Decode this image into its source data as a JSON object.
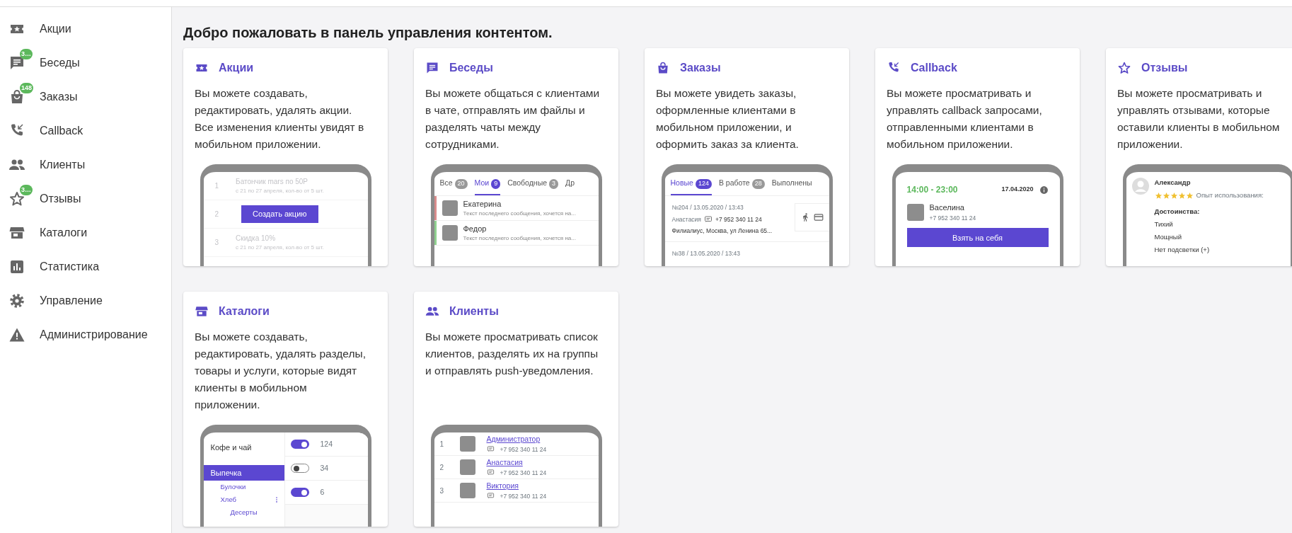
{
  "sidebar": {
    "items": [
      {
        "label": "Акции"
      },
      {
        "label": "Беседы",
        "badge": "3…"
      },
      {
        "label": "Заказы",
        "badge": "148"
      },
      {
        "label": "Callback"
      },
      {
        "label": "Клиенты"
      },
      {
        "label": "Отзывы",
        "badge": "3…"
      },
      {
        "label": "Каталоги"
      },
      {
        "label": "Статистика"
      },
      {
        "label": "Управление"
      },
      {
        "label": "Администрирование"
      }
    ]
  },
  "heading": "Добро пожаловать в панель управления контентом.",
  "cards": [
    {
      "kind": "promos",
      "title": "Акции",
      "text": "Вы можете создавать, редактировать, удалять акции. Все изменения клиенты увидят в мобильном приложении.",
      "preview": {
        "rows": [
          {
            "num": "1",
            "title": "Батончик mars по 50Р",
            "subtitle": "с 21 по 27 апреля, кол-во от 5 шт."
          },
          {
            "num": "2"
          },
          {
            "num": "3",
            "title": "Скидка 10%",
            "subtitle": "с 21 по 27 апреля, кол-во от 5 шт."
          }
        ],
        "button": "Создать акцию"
      }
    },
    {
      "kind": "chats",
      "title": "Беседы",
      "text": "Вы можете общаться с клиентами в чате, отправлять им файлы и разделять чаты между сотрудниками.",
      "preview": {
        "tabs": [
          {
            "label": "Все",
            "count": "20",
            "selected": false
          },
          {
            "label": "Мои",
            "count": "9",
            "selected": true
          },
          {
            "label": "Свободные",
            "count": "3",
            "selected": false
          },
          {
            "label": "Др",
            "selected": false
          }
        ],
        "chats": [
          {
            "name": "Екатерина",
            "message": "Текст последнего сообщения, хочется на...",
            "color": "#d98c8c"
          },
          {
            "name": "Федор",
            "message": "Текст последнего сообщения, хочется на...",
            "color": "#8fd18f"
          }
        ]
      }
    },
    {
      "kind": "orders",
      "title": "Заказы",
      "text": "Вы можете увидеть заказы, оформленные клиентами в мобильном приложении, и оформить заказ за клиента.",
      "preview": {
        "tabs": [
          {
            "label": "Новые",
            "count": "124",
            "selected": true
          },
          {
            "label": "В работе",
            "count": "28",
            "selected": false
          },
          {
            "label": "Выполнены",
            "selected": false
          }
        ],
        "orders": [
          {
            "meta": "№204 / 13.05.2020 / 13:43",
            "customer": "Анастасия",
            "phone": "+7 952 340 11 24",
            "address": "Филиалиус, Москва, ул Ленина 65..."
          },
          {
            "meta": "№38 / 13.05.2020 / 13:43"
          }
        ]
      }
    },
    {
      "kind": "callback",
      "title": "Callback",
      "text": "Вы можете просматривать и управлять callback запросами, отправленными клиентами в мобильном приложении.",
      "preview": {
        "time": "14:00 - 23:00",
        "date": "17.04.2020",
        "name": "Васелина",
        "phone": "+7 952 340 11 24",
        "button": "Взять на себя"
      }
    },
    {
      "kind": "reviews",
      "title": "Отзывы",
      "text": "Вы можете просматривать и управлять отзывами, которые оставили клиенты в мобильном приложении.",
      "preview": {
        "name": "Александр",
        "stars": 5,
        "experience": "Опыт использования:",
        "pros_title": "Достоинства:",
        "pros": [
          "Тихий",
          "Мощный",
          "Нет подсветки (+)"
        ]
      }
    },
    {
      "kind": "catalog",
      "title": "Каталоги",
      "text": "Вы можете создавать, редактировать, удалять разделы, товары и услуги, которые видят клиенты в мобильном приложении.",
      "preview": {
        "categories": [
          {
            "label": "Кофе и чай",
            "selected": false
          },
          {
            "label": "Выпечка",
            "selected": true,
            "children": [
              {
                "label": "Булочки"
              },
              {
                "label": "Хлеб",
                "children": [
                  {
                    "label": "Десерты"
                  }
                ]
              }
            ]
          }
        ],
        "toggles": [
          {
            "on": true,
            "count": "124"
          },
          {
            "on": false,
            "count": "34"
          },
          {
            "on": true,
            "count": "6"
          }
        ]
      }
    },
    {
      "kind": "clients",
      "title": "Клиенты",
      "text": "Вы можете просматривать список клиентов, разделять их на группы и отправлять push-уведомления.",
      "preview": {
        "rows": [
          {
            "num": "1",
            "name": "Администратор",
            "phone": "+7 952 340 11 24"
          },
          {
            "num": "2",
            "name": "Анастасия",
            "phone": "+7 952 340 11 24"
          },
          {
            "num": "3",
            "name": "Виктория",
            "phone": "+7 952 340 11 24"
          }
        ]
      }
    }
  ]
}
